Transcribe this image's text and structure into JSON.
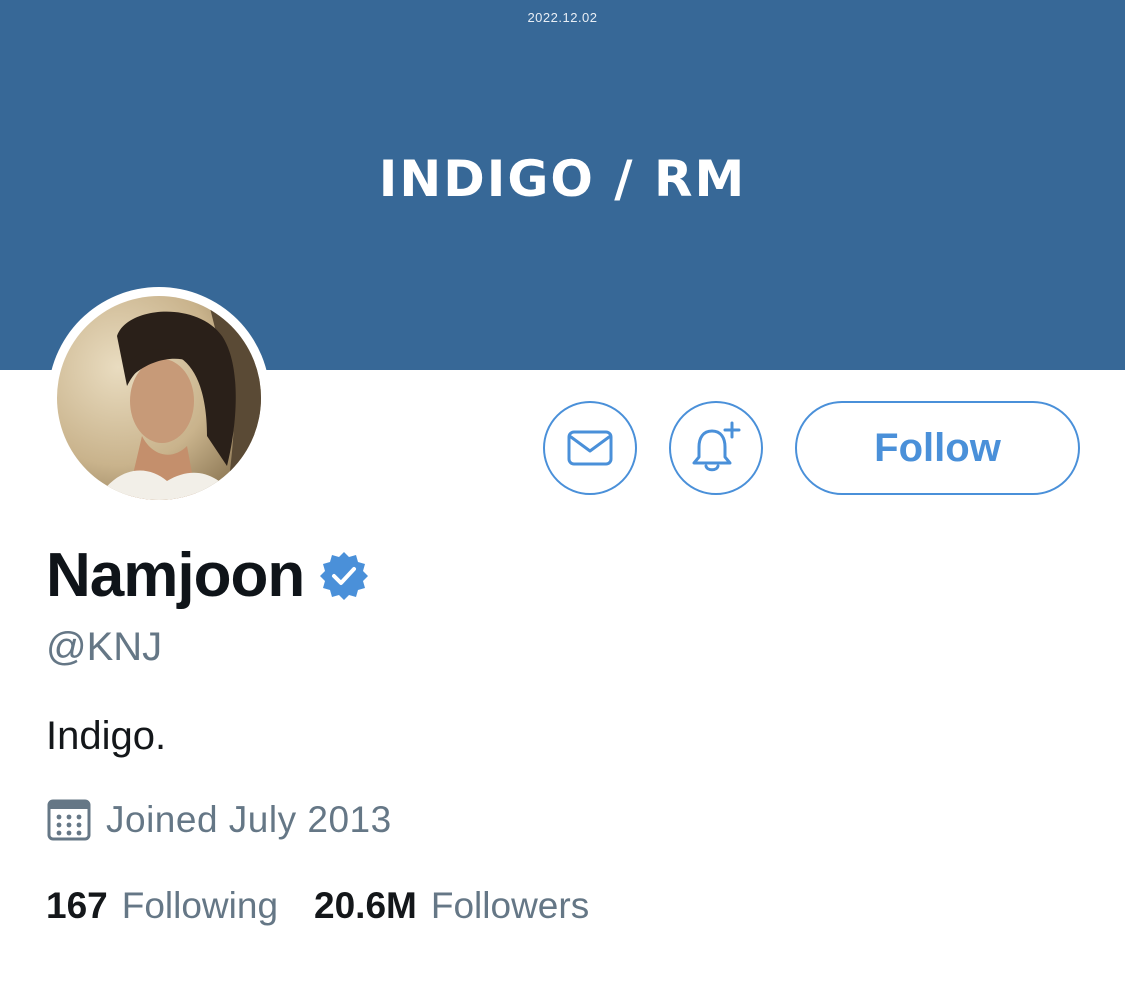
{
  "header": {
    "date_stamp": "2022.12.02",
    "banner_title": "INDIGO / RM",
    "banner_color": "#376897"
  },
  "actions": {
    "message_icon": "envelope-icon",
    "notify_icon": "bell-plus-icon",
    "follow_label": "Follow",
    "accent_color": "#4a90d9"
  },
  "profile": {
    "display_name": "Namjoon",
    "verified": true,
    "verified_icon": "verified-badge-icon",
    "handle": "@KNJ",
    "bio": "Indigo.",
    "joined_icon": "calendar-icon",
    "joined": "Joined July 2013"
  },
  "stats": {
    "following_count": "167",
    "following_label": "Following",
    "followers_count": "20.6M",
    "followers_label": "Followers"
  }
}
